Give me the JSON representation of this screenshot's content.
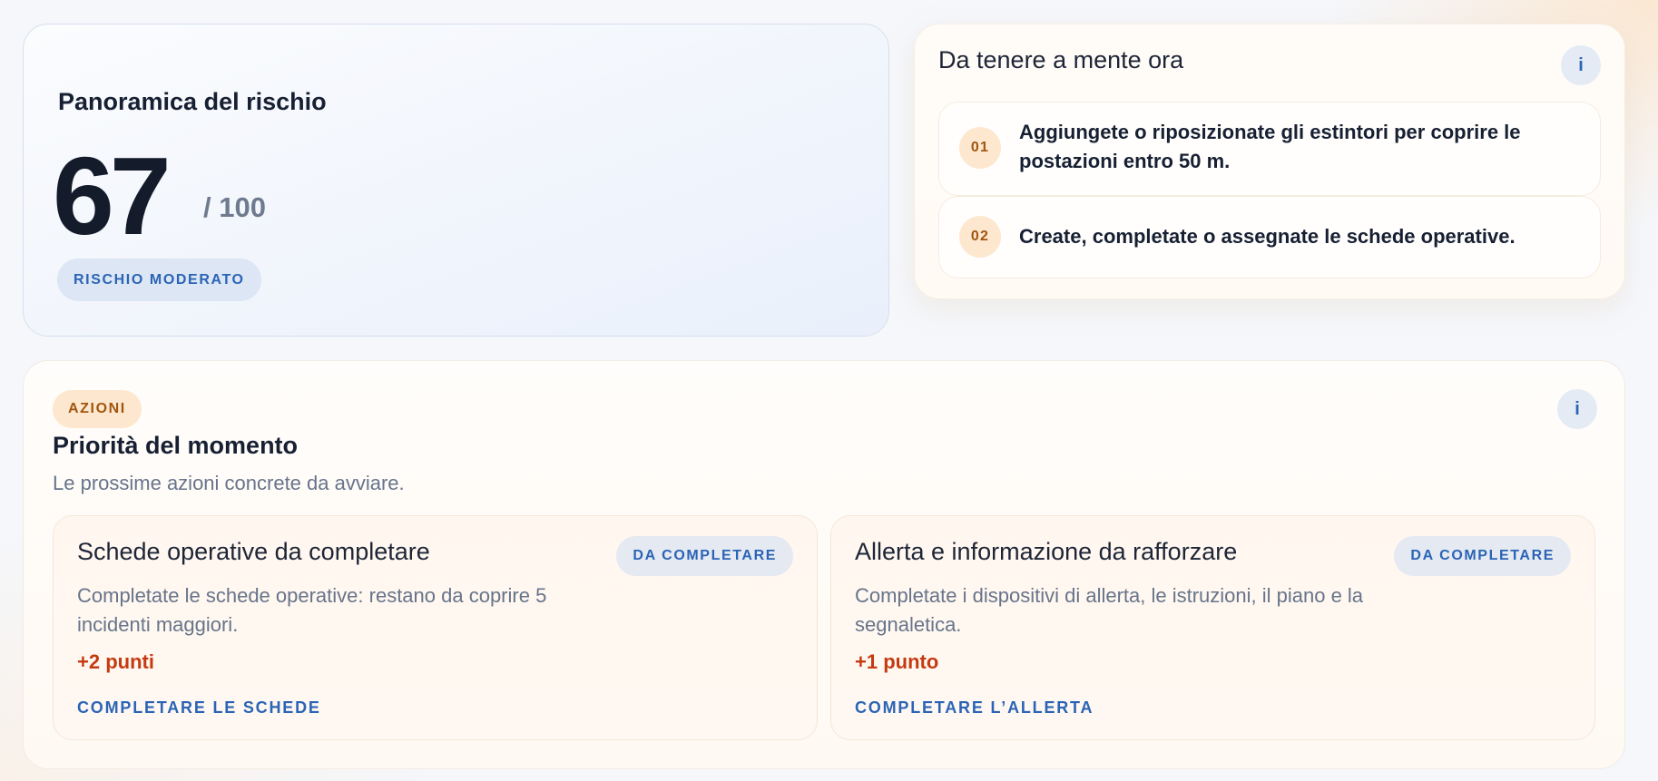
{
  "risk_overview": {
    "title": "Panoramica del rischio",
    "score": "67",
    "score_max": "/ 100",
    "level": "RISCHIO MODERATO"
  },
  "keep_in_mind": {
    "title": "Da tenere a mente ora",
    "info_icon": "i",
    "items": [
      {
        "number": "01",
        "text": "Aggiungete o riposizionate gli estintori per coprire le postazioni entro 50 m."
      },
      {
        "number": "02",
        "text": "Create, completate o assegnate le schede operative."
      }
    ]
  },
  "actions": {
    "tag": "AZIONI",
    "info_icon": "i",
    "title": "Priorità del momento",
    "subtitle": "Le prossime azioni concrete da avviare.",
    "cards": [
      {
        "title": "Schede operative da completare",
        "status": "DA COMPLETARE",
        "description": "Completate le schede operative: restano da coprire 5 incidenti maggiori.",
        "points": "+2 punti",
        "link": "COMPLETARE LE SCHEDE"
      },
      {
        "title": "Allerta e informazione da rafforzare",
        "status": "DA COMPLETARE",
        "description": "Completate i dispositivi di allerta, le istruzioni, il piano e la segnaletica.",
        "points": "+1 punto",
        "link": "COMPLETARE L’ALLERTA"
      }
    ]
  },
  "colors": {
    "accent_blue": "#2b64b5",
    "accent_orange": "#a0560f",
    "points_red": "#c53a11",
    "text_dark": "#172033",
    "text_muted": "#67748a"
  }
}
